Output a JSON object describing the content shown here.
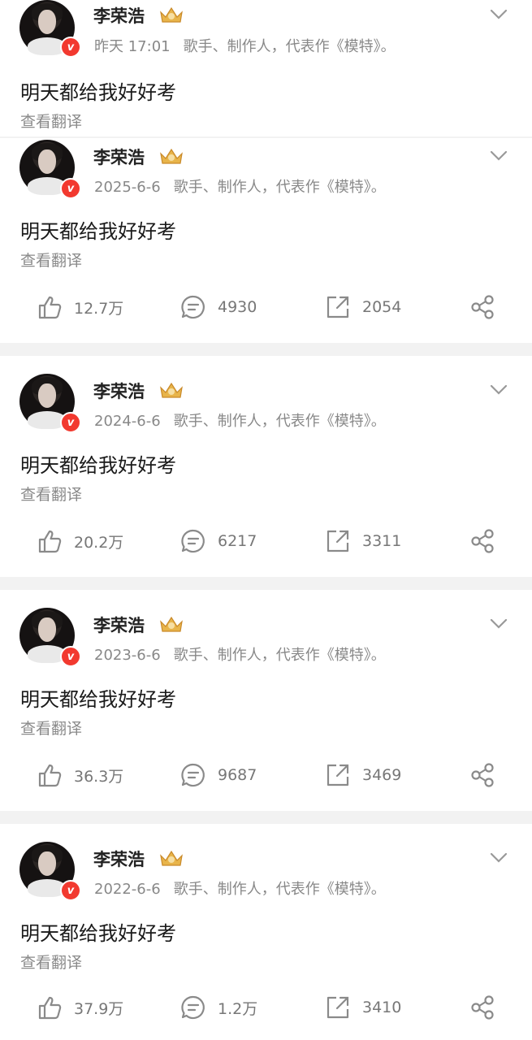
{
  "posts": [
    {
      "author": "李荣浩",
      "time": "昨天 17:01",
      "bio": "歌手、制作人，代表作《模特》。",
      "text": "明天都给我好好考",
      "translate": "查看翻译"
    },
    {
      "author": "李荣浩",
      "time": "2025-6-6",
      "bio": "歌手、制作人，代表作《模特》。",
      "text": "明天都给我好好考",
      "translate": "查看翻译",
      "likes": "12.7万",
      "comments": "4930",
      "reposts": "2054"
    },
    {
      "author": "李荣浩",
      "time": "2024-6-6",
      "bio": "歌手、制作人，代表作《模特》。",
      "text": "明天都给我好好考",
      "translate": "查看翻译",
      "likes": "20.2万",
      "comments": "6217",
      "reposts": "3311"
    },
    {
      "author": "李荣浩",
      "time": "2023-6-6",
      "bio": "歌手、制作人，代表作《模特》。",
      "text": "明天都给我好好考",
      "translate": "查看翻译",
      "likes": "36.3万",
      "comments": "9687",
      "reposts": "3469"
    },
    {
      "author": "李荣浩",
      "time": "2022-6-6",
      "bio": "歌手、制作人，代表作《模特》。",
      "text": "明天都给我好好考",
      "translate": "查看翻译",
      "likes": "37.9万",
      "comments": "1.2万",
      "reposts": "3410"
    }
  ],
  "colors": {
    "accent": "#f2392f",
    "meta": "#888888",
    "icon": "#8a8a8a"
  },
  "icons": [
    "verified-icon",
    "crown-icon",
    "chevron-down-icon",
    "like-icon",
    "comment-icon",
    "repost-icon",
    "share-icon"
  ]
}
